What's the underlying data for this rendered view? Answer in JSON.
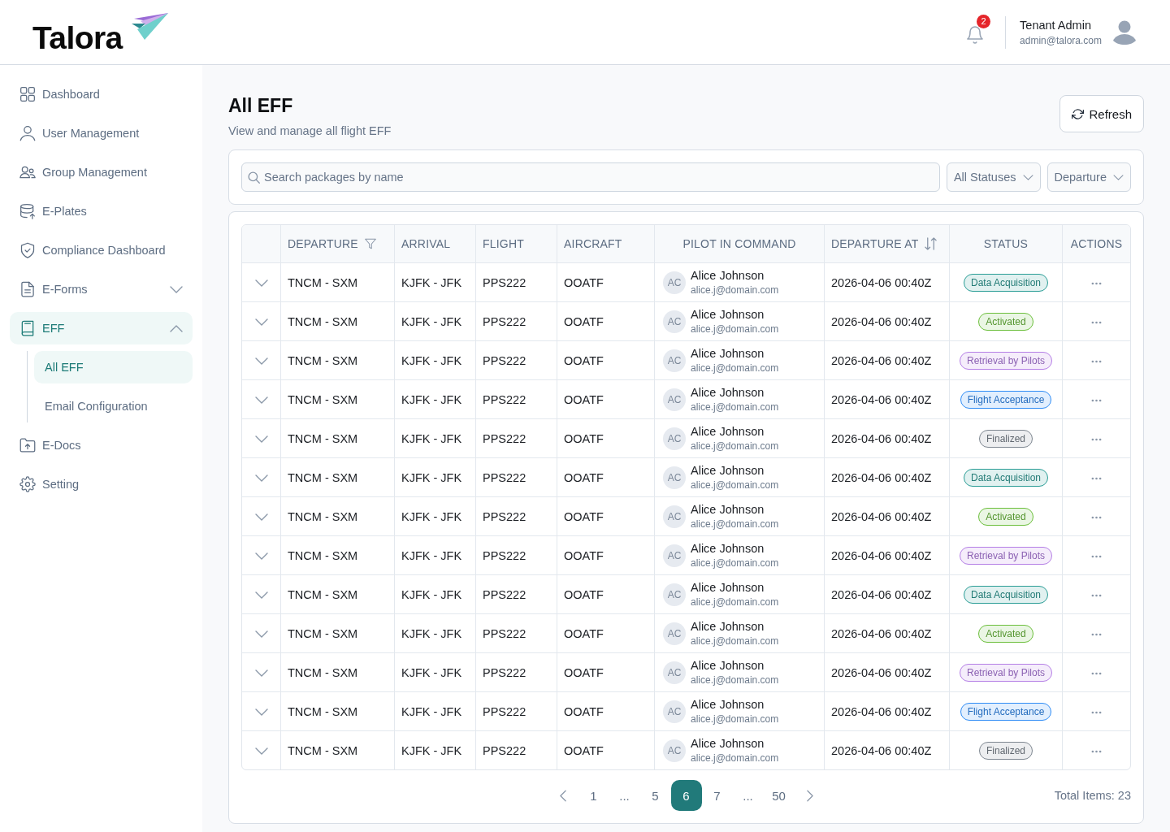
{
  "header": {
    "logo": "Talora",
    "notification_count": "2",
    "user": {
      "name": "Tenant Admin",
      "email": "admin@talora.com"
    }
  },
  "sidebar": {
    "items": [
      {
        "label": "Dashboard",
        "kind": "link",
        "selected": false
      },
      {
        "label": "User Management",
        "kind": "link",
        "selected": false
      },
      {
        "label": "Group Management",
        "kind": "link",
        "selected": false
      },
      {
        "label": "E-Plates",
        "kind": "link",
        "selected": false
      },
      {
        "label": "Compliance Dashboard",
        "kind": "link",
        "selected": false
      },
      {
        "label": "E-Forms",
        "kind": "group",
        "selected": false,
        "expanded": false
      },
      {
        "label": "EFF",
        "kind": "group",
        "selected": true,
        "expanded": true,
        "children": [
          {
            "label": "All EFF",
            "selected": true
          },
          {
            "label": "Email Configuration",
            "selected": false
          }
        ]
      },
      {
        "label": "E-Docs",
        "kind": "link",
        "selected": false
      },
      {
        "label": "Setting",
        "kind": "link",
        "selected": false
      }
    ]
  },
  "page": {
    "title": "All EFF",
    "subtitle": "View and manage all flight EFF",
    "refresh_button": "Refresh"
  },
  "filters": {
    "search": {
      "placeholder": "Search packages by name"
    },
    "dropdowns": [
      {
        "value": "All Statuses"
      },
      {
        "value": "Departure"
      }
    ]
  },
  "table": {
    "columns": [
      {
        "label": "DEPARTURE",
        "kind": "filter"
      },
      {
        "label": "ARRIVAL",
        "kind": "plain"
      },
      {
        "label": "FLIGHT",
        "kind": "plain"
      },
      {
        "label": "AIRCRAFT",
        "kind": "plain"
      },
      {
        "label": "PILOT IN COMMAND",
        "kind": "plain"
      },
      {
        "label": "DEPARTURE AT",
        "kind": "sort"
      },
      {
        "label": "STATUS",
        "kind": "plain"
      },
      {
        "label": "ACTIONS",
        "kind": "plain"
      }
    ],
    "rows": [
      {
        "expanded": false,
        "departure": "TNCM - SXM",
        "arrival": "KJFK - JFK",
        "flight": "PPS222",
        "aircraft": "OOATF",
        "pilot": {
          "initials": "AC",
          "name": "Alice Johnson",
          "email": "alice.j@domain.com"
        },
        "departure_at": "2026-04-06 00:40Z",
        "status": {
          "label": "Data Acquisition",
          "color": "#2a9d96"
        }
      },
      {
        "expanded": false,
        "departure": "TNCM - SXM",
        "arrival": "KJFK - JFK",
        "flight": "PPS222",
        "aircraft": "OOATF",
        "pilot": {
          "initials": "AC",
          "name": "Alice Johnson",
          "email": "alice.j@domain.com"
        },
        "departure_at": "2026-04-06 00:40Z",
        "status": {
          "label": "Activated",
          "color": "#6cbf3c"
        }
      },
      {
        "expanded": false,
        "departure": "TNCM - SXM",
        "arrival": "KJFK - JFK",
        "flight": "PPS222",
        "aircraft": "OOATF",
        "pilot": {
          "initials": "AC",
          "name": "Alice Johnson",
          "email": "alice.j@domain.com"
        },
        "departure_at": "2026-04-06 00:40Z",
        "status": {
          "label": "Retrieval by Pilots",
          "color": "#b47ee5"
        }
      },
      {
        "expanded": false,
        "departure": "TNCM - SXM",
        "arrival": "KJFK - JFK",
        "flight": "PPS222",
        "aircraft": "OOATF",
        "pilot": {
          "initials": "AC",
          "name": "Alice Johnson",
          "email": "alice.j@domain.com"
        },
        "departure_at": "2026-04-06 00:40Z",
        "status": {
          "label": "Flight Acceptance",
          "color": "#2f8cf5"
        }
      },
      {
        "expanded": false,
        "departure": "TNCM - SXM",
        "arrival": "KJFK - JFK",
        "flight": "PPS222",
        "aircraft": "OOATF",
        "pilot": {
          "initials": "AC",
          "name": "Alice Johnson",
          "email": "alice.j@domain.com"
        },
        "departure_at": "2026-04-06 00:40Z",
        "status": {
          "label": "Finalized",
          "color": "#7e8791"
        }
      },
      {
        "expanded": false,
        "departure": "TNCM - SXM",
        "arrival": "KJFK - JFK",
        "flight": "PPS222",
        "aircraft": "OOATF",
        "pilot": {
          "initials": "AC",
          "name": "Alice Johnson",
          "email": "alice.j@domain.com"
        },
        "departure_at": "2026-04-06 00:40Z",
        "status": {
          "label": "Data Acquisition",
          "color": "#2a9d96"
        }
      },
      {
        "expanded": false,
        "departure": "TNCM - SXM",
        "arrival": "KJFK - JFK",
        "flight": "PPS222",
        "aircraft": "OOATF",
        "pilot": {
          "initials": "AC",
          "name": "Alice Johnson",
          "email": "alice.j@domain.com"
        },
        "departure_at": "2026-04-06 00:40Z",
        "status": {
          "label": "Activated",
          "color": "#6cbf3c"
        }
      },
      {
        "expanded": false,
        "departure": "TNCM - SXM",
        "arrival": "KJFK - JFK",
        "flight": "PPS222",
        "aircraft": "OOATF",
        "pilot": {
          "initials": "AC",
          "name": "Alice Johnson",
          "email": "alice.j@domain.com"
        },
        "departure_at": "2026-04-06 00:40Z",
        "status": {
          "label": "Retrieval by Pilots",
          "color": "#b47ee5"
        }
      },
      {
        "expanded": false,
        "departure": "TNCM - SXM",
        "arrival": "KJFK - JFK",
        "flight": "PPS222",
        "aircraft": "OOATF",
        "pilot": {
          "initials": "AC",
          "name": "Alice Johnson",
          "email": "alice.j@domain.com"
        },
        "departure_at": "2026-04-06 00:40Z",
        "status": {
          "label": "Data Acquisition",
          "color": "#2a9d96"
        }
      },
      {
        "expanded": false,
        "departure": "TNCM - SXM",
        "arrival": "KJFK - JFK",
        "flight": "PPS222",
        "aircraft": "OOATF",
        "pilot": {
          "initials": "AC",
          "name": "Alice Johnson",
          "email": "alice.j@domain.com"
        },
        "departure_at": "2026-04-06 00:40Z",
        "status": {
          "label": "Activated",
          "color": "#6cbf3c"
        }
      },
      {
        "expanded": false,
        "departure": "TNCM - SXM",
        "arrival": "KJFK - JFK",
        "flight": "PPS222",
        "aircraft": "OOATF",
        "pilot": {
          "initials": "AC",
          "name": "Alice Johnson",
          "email": "alice.j@domain.com"
        },
        "departure_at": "2026-04-06 00:40Z",
        "status": {
          "label": "Retrieval by Pilots",
          "color": "#b47ee5"
        }
      },
      {
        "expanded": false,
        "departure": "TNCM - SXM",
        "arrival": "KJFK - JFK",
        "flight": "PPS222",
        "aircraft": "OOATF",
        "pilot": {
          "initials": "AC",
          "name": "Alice Johnson",
          "email": "alice.j@domain.com"
        },
        "departure_at": "2026-04-06 00:40Z",
        "status": {
          "label": "Flight Acceptance",
          "color": "#2f8cf5"
        }
      },
      {
        "expanded": false,
        "departure": "TNCM - SXM",
        "arrival": "KJFK - JFK",
        "flight": "PPS222",
        "aircraft": "OOATF",
        "pilot": {
          "initials": "AC",
          "name": "Alice Johnson",
          "email": "alice.j@domain.com"
        },
        "departure_at": "2026-04-06 00:40Z",
        "status": {
          "label": "Finalized",
          "color": "#7e8791"
        }
      }
    ]
  },
  "pagination": {
    "pages": [
      {
        "kind": "page",
        "label": "1",
        "selected": false
      },
      {
        "kind": "gap",
        "label": "..."
      },
      {
        "kind": "page",
        "label": "5",
        "selected": false
      },
      {
        "kind": "page",
        "label": "6",
        "selected": true
      },
      {
        "kind": "page",
        "label": "7",
        "selected": false
      },
      {
        "kind": "gap",
        "label": "..."
      },
      {
        "kind": "page",
        "label": "50",
        "selected": false
      }
    ],
    "total": "Total Items: 23"
  }
}
